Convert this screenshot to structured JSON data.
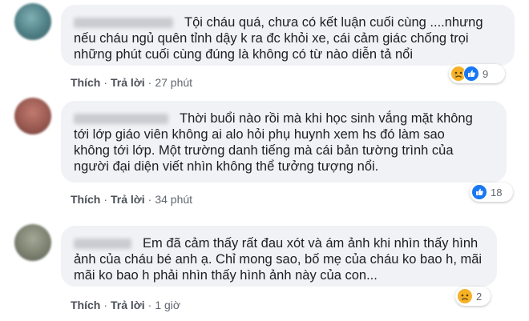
{
  "comments": [
    {
      "text_lines": [
        "Tội cháu quá, chưa có kết luận cuối cùng ....nhưng",
        "nếu cháu ngủ quên tỉnh dậy k ra đc khỏi xe, cái cảm giác chống trọi",
        "những phút cuối cùng đúng là không có từ nào diễn tả nổi"
      ],
      "like_label": "Thích",
      "reply_label": "Trả lời",
      "separator": "·",
      "time": "27 phút",
      "reaction_count": "9",
      "reaction_icons": [
        "sad-icon",
        "like-icon"
      ],
      "avatar_color": "#5f8f95"
    },
    {
      "text_lines": [
        "Thời buổi nào rồi mà khi học sinh vắng mặt không",
        "tới lớp giáo viên không ai alo hỏi phụ huynh xem hs đó làm sao",
        "không tới lớp. Một trường danh tiếng mà cái bản tường trình của",
        "người đại diện viết nhìn không thể tưởng tượng nổi."
      ],
      "like_label": "Thích",
      "reply_label": "Trả lời",
      "separator": "·",
      "time": "34 phút",
      "reaction_count": "18",
      "reaction_icons": [
        "like-icon"
      ],
      "avatar_color": "#9a5a52"
    },
    {
      "text_lines": [
        "Em đã cảm thấy rất đau xót và ám ảnh khi nhìn thấy hình",
        "ảnh của cháu bé anh ạ. Chỉ mong sao, bố mẹ của cháu ko bao h, mãi",
        "mãi ko bao h phải nhìn thấy hình ảnh này của con..."
      ],
      "like_label": "Thích",
      "reply_label": "Trả lời",
      "separator": "·",
      "time": "1 giờ",
      "reaction_count": "2",
      "reaction_icons": [
        "sad-icon"
      ],
      "avatar_color": "#8a8f7e"
    }
  ],
  "colors": {
    "bubble": "#f0f2f5",
    "like_blue": "#1877f2",
    "sad_yellow": "#f7b125"
  }
}
